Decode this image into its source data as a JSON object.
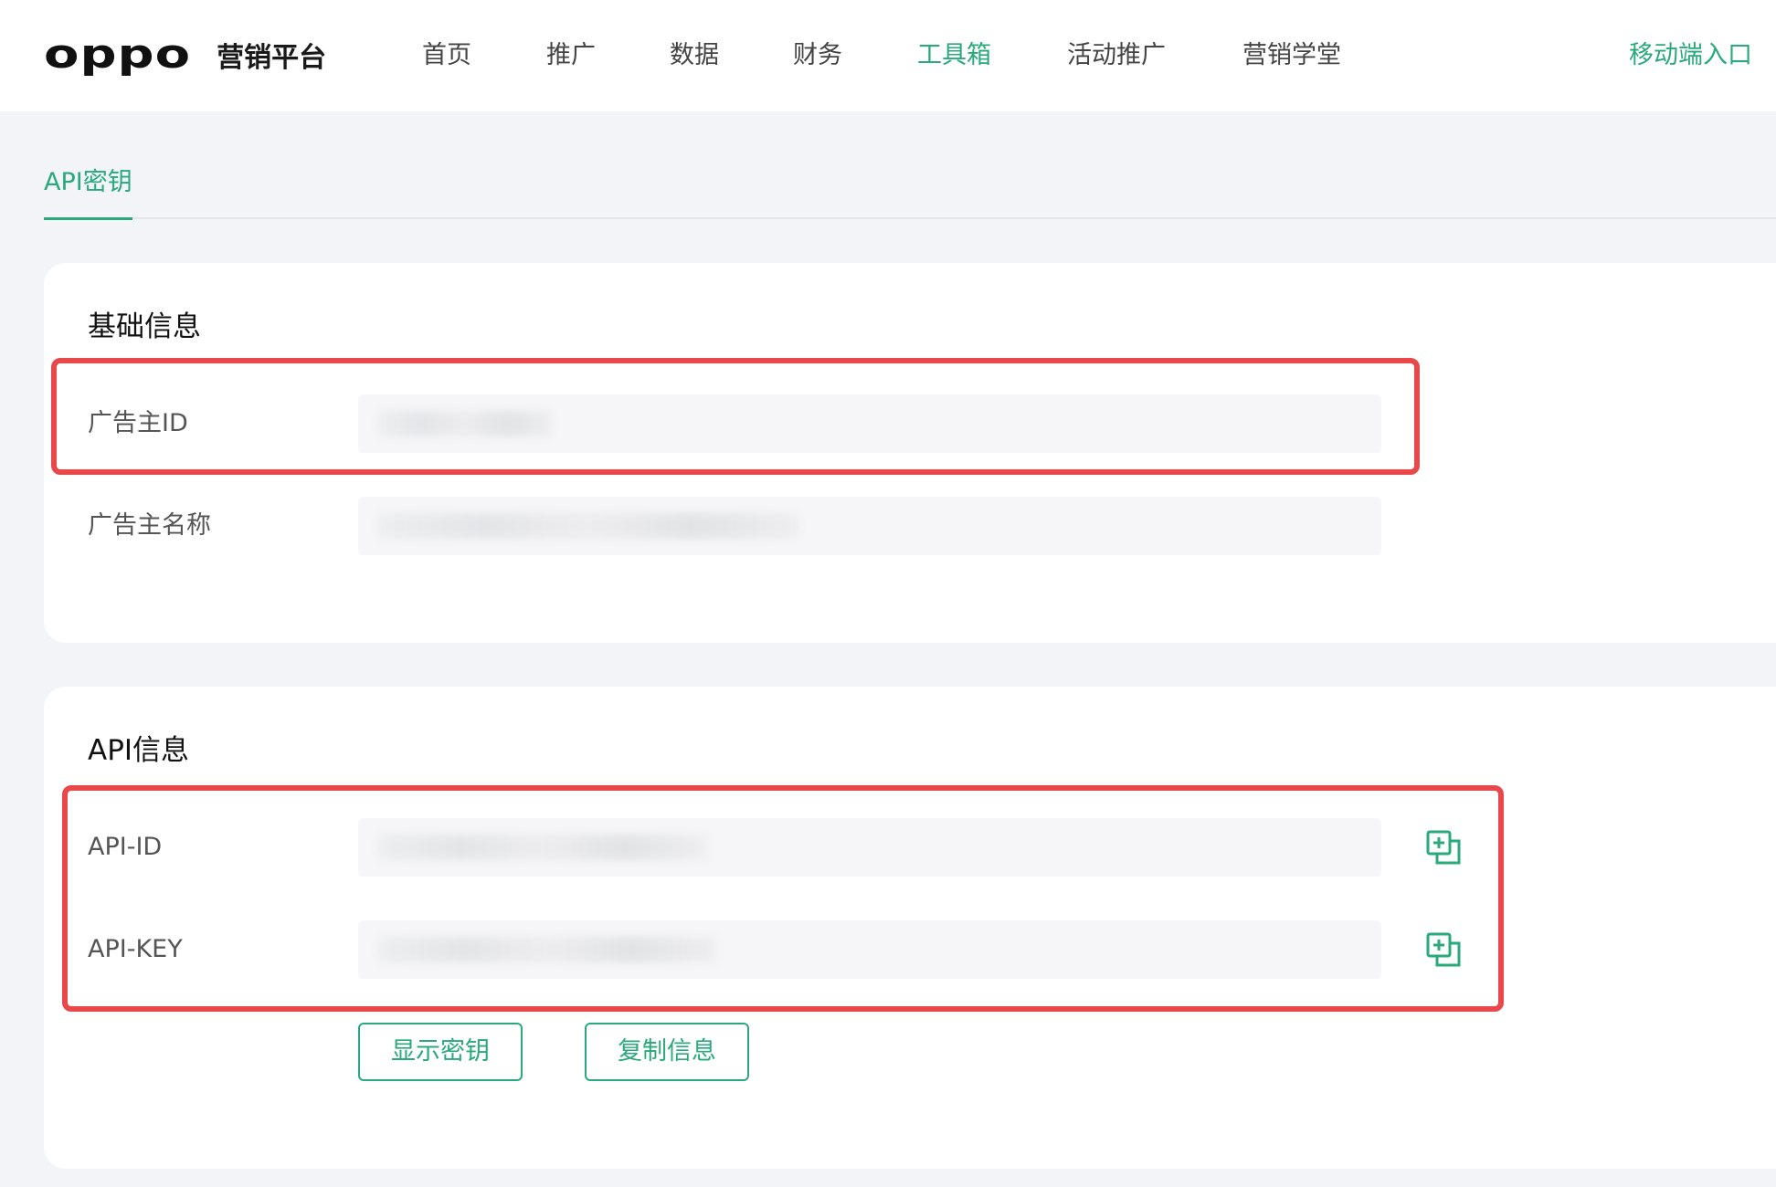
{
  "header": {
    "brand": "oppo",
    "platform": "营销平台",
    "nav": [
      {
        "label": "首页",
        "active": false
      },
      {
        "label": "推广",
        "active": false
      },
      {
        "label": "数据",
        "active": false
      },
      {
        "label": "财务",
        "active": false
      },
      {
        "label": "工具箱",
        "active": true
      },
      {
        "label": "活动推广",
        "active": false
      },
      {
        "label": "营销学堂",
        "active": false
      }
    ],
    "mobile_entry": "移动端入口"
  },
  "tabs": [
    {
      "label": "API密钥",
      "active": true
    }
  ],
  "basic_info": {
    "title": "基础信息",
    "fields": [
      {
        "label": "广告主ID",
        "value": ""
      },
      {
        "label": "广告主名称",
        "value": ""
      }
    ]
  },
  "api_info": {
    "title": "API信息",
    "fields": [
      {
        "label": "API-ID",
        "value": ""
      },
      {
        "label": "API-KEY",
        "value": ""
      }
    ],
    "buttons": {
      "show_key": "显示密钥",
      "copy_info": "复制信息"
    }
  },
  "icons": {
    "copy": "copy-icon"
  },
  "colors": {
    "accent": "#2aa97a",
    "highlight": "#e8484a",
    "background": "#f3f4f8"
  }
}
